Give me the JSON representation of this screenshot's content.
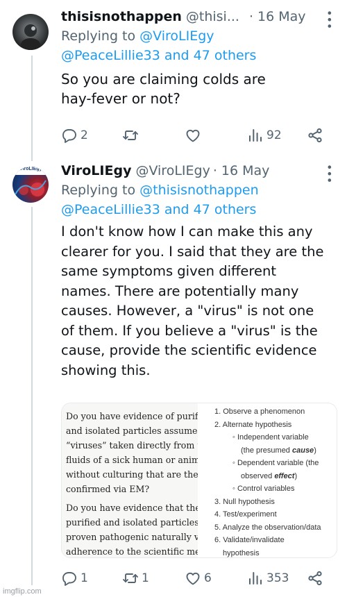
{
  "tweets": [
    {
      "name": "thisisnothappen",
      "handle": "@thisi...",
      "time": "· 16 May",
      "reply_prefix": "Replying to ",
      "reply_to": "@ViroLIEgy",
      "reply_line2_handle": "@PeaceLillie33",
      "reply_and": " and ",
      "reply_others": "47 others",
      "text_line1": "So you are claiming colds are",
      "text_line2": "hay-fever or not?",
      "replies": "2",
      "reposts": "",
      "likes": "",
      "views": "92"
    },
    {
      "name": "ViroLIEgy",
      "handle": "@ViroLIEgy",
      "time": "· 16 May",
      "avatar_text": "ViroLIEgy",
      "reply_prefix": "Replying to ",
      "reply_to": "@thisisnothappen",
      "reply_line2_handle": "@PeaceLillie33",
      "reply_and": " and ",
      "reply_others": "47 others",
      "text_lines": [
        "I don't know how I can make this any",
        "clearer for you. I said that they are the",
        "same symptoms given different",
        "names. There are potentially many",
        "causes. However, a \"virus\" is not one",
        "of them. If you believe a \"virus\" is the",
        "cause, provide the scientific evidence",
        "showing this."
      ],
      "replies": "1",
      "reposts": "1",
      "likes": "6",
      "views": "353"
    }
  ],
  "media": {
    "left_lines": [
      "Do you have evidence of purified",
      "and isolated particles assumed to",
      "“viruses” taken directly from the",
      "fluids of a sick human or animal",
      "without culturing that are then",
      "confirmed via EM?",
      "Do you have evidence that these",
      "purified and isolated particles w",
      "proven pathogenic naturally via",
      "adherence to the scientific meth"
    ],
    "right_lines": [
      "1. Observe a phenomenon",
      "2. Alternate hypothesis",
      "◦ Independent variable",
      "(the presumed cause)",
      "◦ Dependent variable (the",
      "observed effect)",
      "◦ Control variables",
      "3. Null hypothesis",
      "4. Test/experiment",
      "5. Analyze the observation/data",
      "6. Validate/invalidate",
      "hypothesis"
    ]
  },
  "watermark": "imgflip.com",
  "colors": {
    "link": "#1d9bf0",
    "muted": "#536471",
    "text": "#0f1419"
  }
}
